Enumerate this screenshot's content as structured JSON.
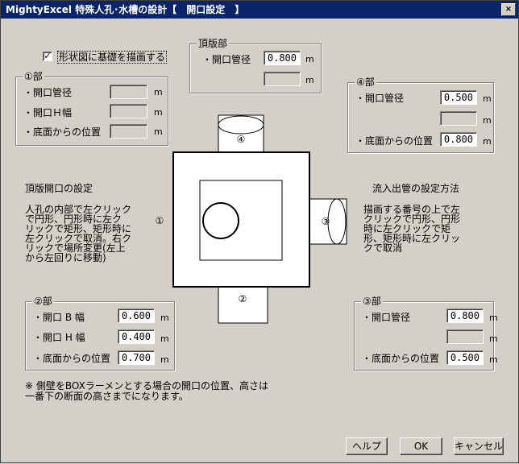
{
  "window": {
    "title": "MightyExcel 特殊人孔･水槽の設計【　開口設定　】",
    "close_glyph": "×"
  },
  "checkbox_foundation": {
    "label": "形状図に基礎を描画する",
    "checked_glyph": "✓"
  },
  "unit": "m",
  "group1": {
    "title": "①部",
    "diameter_label": "・開口管径",
    "width_h_label": "・開口Ｈ幅",
    "height_label": "・底面からの位置",
    "diameter_value": "",
    "width_h_value": "",
    "height_value": ""
  },
  "top_group": {
    "title": "頂版部",
    "diameter_label": "・開口管径",
    "diameter_value": "0.800",
    "second_value": ""
  },
  "group4": {
    "title": "④部",
    "diameter_label": "・開口管径",
    "diameter_value": "0.500",
    "second_value": "",
    "height_label": "・底面からの位置",
    "height_value": "0.800"
  },
  "group2": {
    "title": "②部",
    "width_b_label": "・開口 B 幅",
    "width_b_value": "0.600",
    "width_h_label": "・開口 H 幅",
    "width_h_value": "0.400",
    "height_label": "・底面からの位置",
    "height_value": "0.700"
  },
  "group3": {
    "title": "③部",
    "diameter_label": "・開口管径",
    "diameter_value": "0.800",
    "second_value": "",
    "height_label": "・底面からの位置",
    "height_value": "0.500"
  },
  "left_help": {
    "heading": "頂版開口の設定",
    "lines": [
      "人孔の内部で左クリック",
      "で円形、円形時に左ク",
      "リックで矩形、矩形時に",
      "左クリックで取消。右ク",
      "リックで場所変更(左上",
      "から左回りに移動)"
    ]
  },
  "right_help": {
    "heading": "流入出管の設定方法",
    "lines": [
      "描画する番号の上で左",
      "クリックで円形、円形",
      "時に左クリックで矩",
      "形、矩形時に左クリッ",
      "クで取消"
    ]
  },
  "diagram": {
    "mark1": "①",
    "mark2": "②",
    "mark3": "③",
    "mark4": "④"
  },
  "footnote": {
    "line1": "※ 側壁をBOXラーメンとする場合の開口の位置、高さは",
    "line2": "一番下の断面の高さまでになります。"
  },
  "buttons": {
    "help": "ヘルプ",
    "ok": "OK",
    "cancel": "キャンセル"
  }
}
